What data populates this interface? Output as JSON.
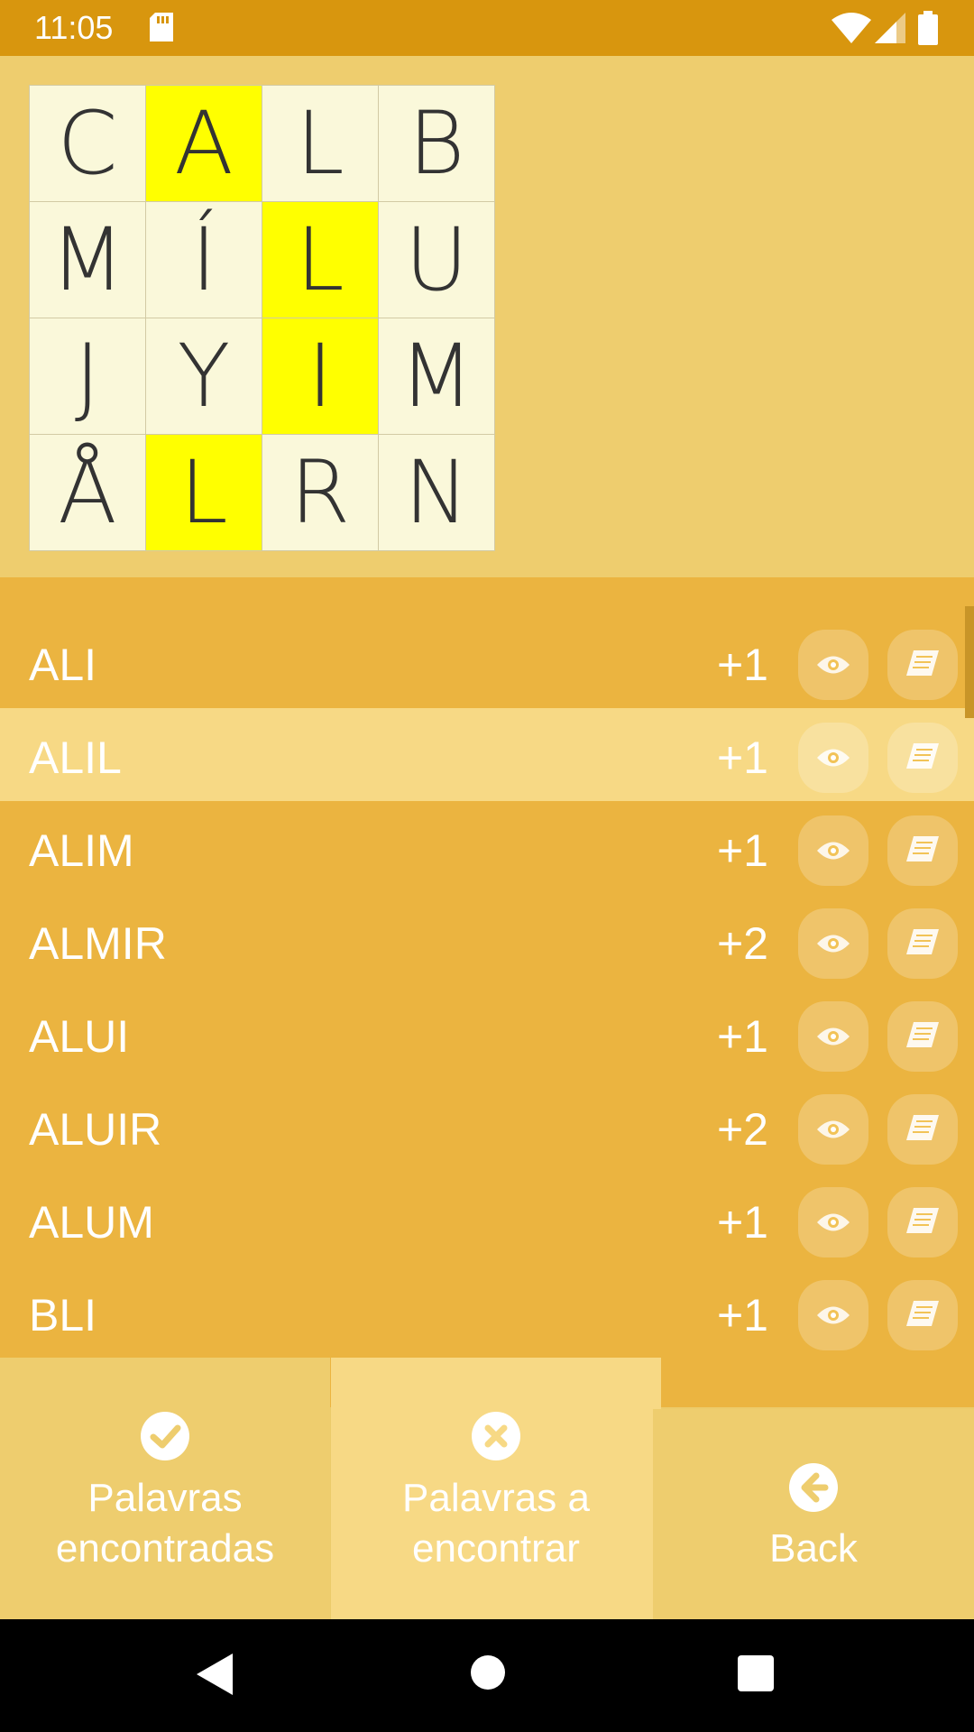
{
  "status": {
    "time": "11:05"
  },
  "board": {
    "rows": [
      [
        {
          "letter": "C",
          "highlighted": false
        },
        {
          "letter": "A",
          "highlighted": true
        },
        {
          "letter": "L",
          "highlighted": false
        },
        {
          "letter": "B",
          "highlighted": false
        }
      ],
      [
        {
          "letter": "M",
          "highlighted": false
        },
        {
          "letter": "Í",
          "highlighted": false
        },
        {
          "letter": "L",
          "highlighted": true
        },
        {
          "letter": "U",
          "highlighted": false
        }
      ],
      [
        {
          "letter": "J",
          "highlighted": false
        },
        {
          "letter": "Y",
          "highlighted": false
        },
        {
          "letter": "I",
          "highlighted": true
        },
        {
          "letter": "M",
          "highlighted": false
        }
      ],
      [
        {
          "letter": "Å",
          "highlighted": false
        },
        {
          "letter": "L",
          "highlighted": true
        },
        {
          "letter": "R",
          "highlighted": false
        },
        {
          "letter": "N",
          "highlighted": false
        }
      ]
    ]
  },
  "words": [
    {
      "word": "ALI",
      "score": "+1",
      "selected": false
    },
    {
      "word": "ALIL",
      "score": "+1",
      "selected": true
    },
    {
      "word": "ALIM",
      "score": "+1",
      "selected": false
    },
    {
      "word": "ALMIR",
      "score": "+2",
      "selected": false
    },
    {
      "word": "ALUI",
      "score": "+1",
      "selected": false
    },
    {
      "word": "ALUIR",
      "score": "+2",
      "selected": false
    },
    {
      "word": "ALUM",
      "score": "+1",
      "selected": false
    },
    {
      "word": "BLI",
      "score": "+1",
      "selected": false
    }
  ],
  "tabs": {
    "found": {
      "line1": "Palavras",
      "line2": "encontradas"
    },
    "tofind": {
      "line1": "Palavras a",
      "line2": "encontrar"
    },
    "back": {
      "label": "Back"
    }
  },
  "colors": {
    "status_bar": "#D8960E",
    "highlight": "#FFFF00",
    "list_bg": "#EBB440",
    "selected_row": "#F7D985"
  }
}
